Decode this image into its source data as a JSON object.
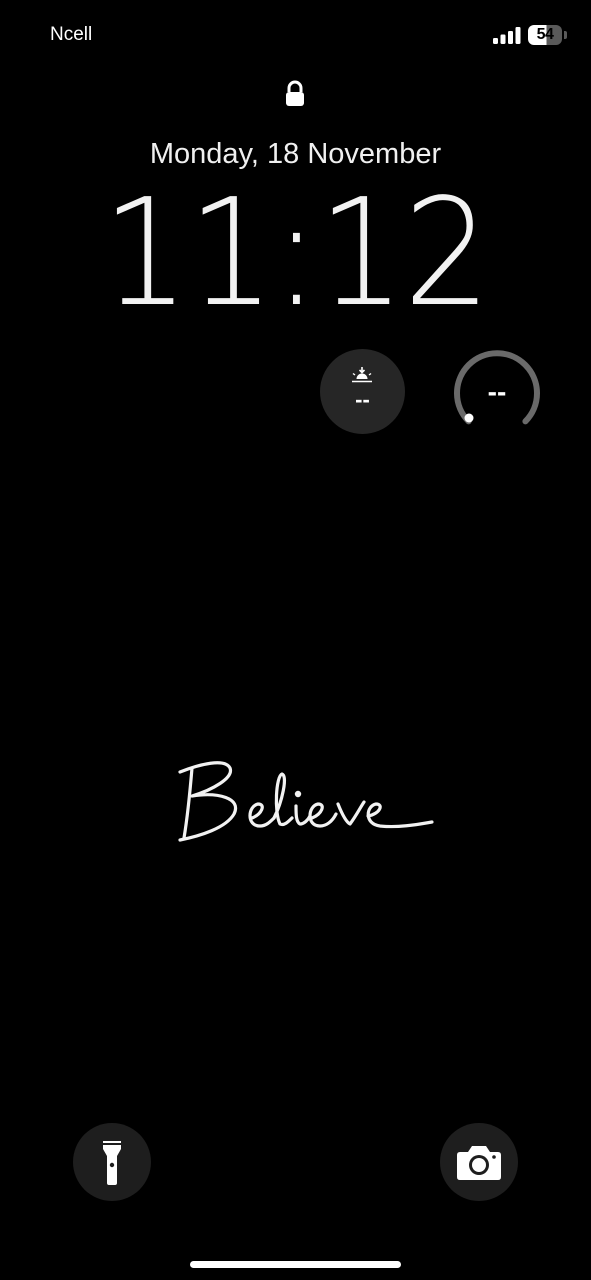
{
  "status_bar": {
    "carrier": "Ncell",
    "battery_percent": "54",
    "battery_level": 0.54,
    "signal_bars": 4
  },
  "lock_screen": {
    "date": "Monday, 18 November",
    "time": "11:12"
  },
  "widgets": {
    "sunset": {
      "icon": "sunset-icon",
      "value": "--"
    },
    "gauge": {
      "icon": "gauge-ring-icon",
      "value": "--"
    }
  },
  "wallpaper": {
    "handwritten_text": "Believe"
  },
  "bottom_controls": {
    "left": "flashlight-icon",
    "right": "camera-icon"
  },
  "colors": {
    "background": "#000000",
    "text": "#ffffff",
    "widget_bg": "#262626",
    "button_bg": "#1e1e1e"
  }
}
